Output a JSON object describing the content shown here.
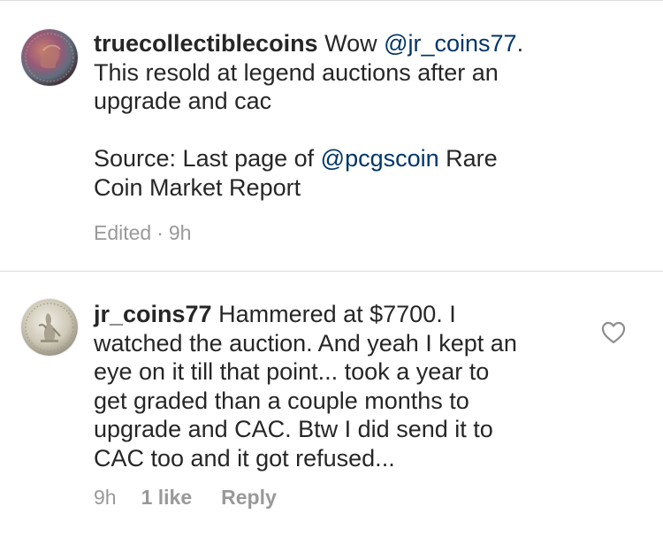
{
  "comments": [
    {
      "username": "truecollectiblecoins",
      "text_parts": [
        {
          "type": "text",
          "value": " Wow "
        },
        {
          "type": "mention",
          "value": "@jr_coins77"
        },
        {
          "type": "text",
          "value": ".\nThis resold at legend auctions after an\nupgrade and cac\n\nSource: Last page of "
        },
        {
          "type": "mention",
          "value": "@pcgscoin"
        },
        {
          "type": "text",
          "value": " Rare\nCoin Market Report"
        }
      ],
      "edited_label": "Edited",
      "separator": "·",
      "timestamp": "9h",
      "avatar_icon": "coin-avatar-copper"
    },
    {
      "username": "jr_coins77",
      "text": " Hammered at $7700. I\nwatched the auction. And yeah I kept an\neye on it till that point... took a year to\nget graded than a couple months to\nupgrade and CAC. Btw I did send it to\nCAC too and it got refused...",
      "timestamp": "9h",
      "likes_label": "1 like",
      "reply_label": "Reply",
      "like_icon": "heart-outline-icon",
      "avatar_icon": "coin-avatar-silver"
    }
  ],
  "colors": {
    "text": "#262626",
    "mention": "#003569",
    "meta": "#999999",
    "divider": "#dbdbdb"
  }
}
